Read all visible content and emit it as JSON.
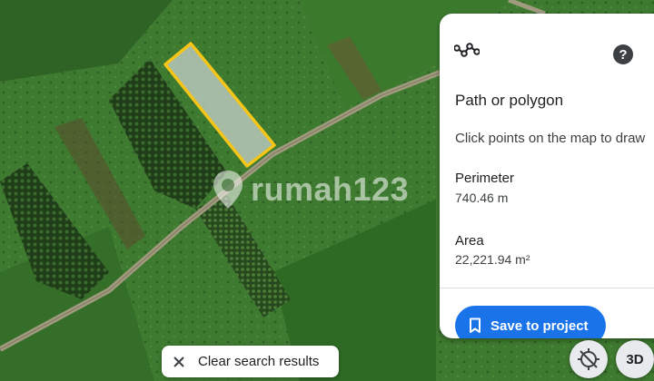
{
  "colors": {
    "polygon_outline": "#f5c518",
    "polygon_fill": "#b7c7bb",
    "primary_button": "#1a73e8",
    "road": "#a09a7e"
  },
  "map": {
    "watermark": "rumah123"
  },
  "panel": {
    "icon": "path-polygon-icon",
    "title": "Path or polygon",
    "hint": "Click points on the map to draw",
    "perimeter_label": "Perimeter",
    "perimeter_value": "740.46 m",
    "area_label": "Area",
    "area_value": "22,221.94 m²",
    "help_icon": "help-icon",
    "save_label": "Save to project",
    "save_icon": "bookmark-icon"
  },
  "search": {
    "clear_label": "Clear search results",
    "clear_icon": "close-icon"
  },
  "controls": {
    "orientation_icon": "compass-icon",
    "view_3d_label": "3D"
  }
}
